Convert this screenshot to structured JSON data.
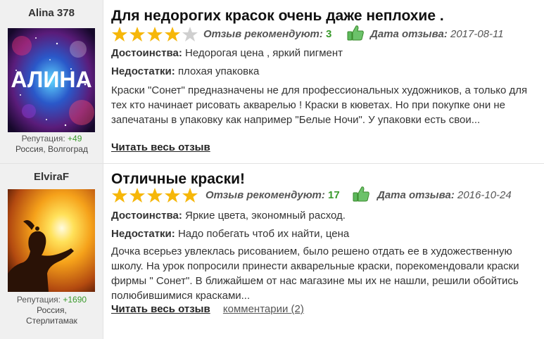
{
  "reviews": [
    {
      "username": "Alina 378",
      "avatar_text": "АЛИНА",
      "reputation_label": "Репутация:",
      "reputation_value": "+49",
      "location": "Россия, Волгоград",
      "title": "Для недорогих красок очень даже неплохие .",
      "rating": 4,
      "rating_max": 5,
      "recommend_label": "Отзыв рекомендуют:",
      "recommend_count": "3",
      "date_label": "Дата отзыва:",
      "date": "2017-08-11",
      "pros_label": "Достоинства:",
      "pros": "Недорогая цена , яркий пигмент",
      "cons_label": "Недостатки:",
      "cons": "плохая упаковка",
      "text": "Краски \"Сонет\" предназначены не для профессиональных художников, а только для тех кто начинает рисовать акварелью ! Краски в кюветах. Но при покупке они не запечатаны в упаковку как например \"Белые Ночи\". У упаковки есть свои...",
      "read_more": "Читать весь отзыв",
      "comments": ""
    },
    {
      "username": "ElviraF",
      "avatar_text": "",
      "reputation_label": "Репутация:",
      "reputation_value": "+1690",
      "location_line1": "Россия,",
      "location_line2": "Стерлитамак",
      "title": "Отличные краски!",
      "rating": 5,
      "rating_max": 5,
      "recommend_label": "Отзыв рекомендуют:",
      "recommend_count": "17",
      "date_label": "Дата отзыва:",
      "date": "2016-10-24",
      "pros_label": "Достоинства:",
      "pros": "Яркие цвета, экономный расход.",
      "cons_label": "Недостатки:",
      "cons": "Надо побегать чтоб их найти, цена",
      "text": "Дочка всерьез увлеклась рисованием, было решено отдать ее в художественную школу. На урок попросили принести акварельные краски, порекомендовали краски фирмы \" Сонет\". В ближайшем от нас магазине мы их не нашли, решили обойтись полюбившимися красками...",
      "read_more": "Читать весь отзыв",
      "comments": "комментарии (2)"
    }
  ],
  "colors": {
    "star_filled": "#f6b70a",
    "star_empty": "#cfcfcf",
    "accent_green": "#3a9a2c",
    "sidebar_bg": "#f0f0f0"
  },
  "icons": [
    "star-icon",
    "thumbs-up-icon"
  ]
}
